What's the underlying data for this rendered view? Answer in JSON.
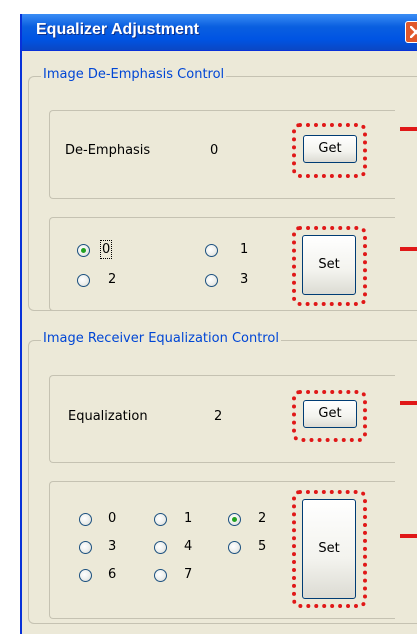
{
  "window": {
    "title": "Equalizer Adjustment"
  },
  "de_emphasis": {
    "group_label": "Image De-Emphasis Control",
    "label": "De-Emphasis",
    "value": "0",
    "get_label": "Get",
    "set_label": "Set",
    "options": [
      "0",
      "1",
      "2",
      "3"
    ],
    "selected": "0"
  },
  "equalization": {
    "group_label": "Image Receiver Equalization Control",
    "label": "Equalization",
    "value": "2",
    "get_label": "Get",
    "set_label": "Set",
    "options": [
      "0",
      "1",
      "2",
      "3",
      "4",
      "5",
      "6",
      "7"
    ],
    "selected": "2"
  },
  "colors": {
    "titlebar": "#0054e3",
    "dialog_bg": "#ece9d8",
    "group_label": "#0046d5",
    "highlight": "#e01818",
    "radio_checked": "#21a121"
  }
}
